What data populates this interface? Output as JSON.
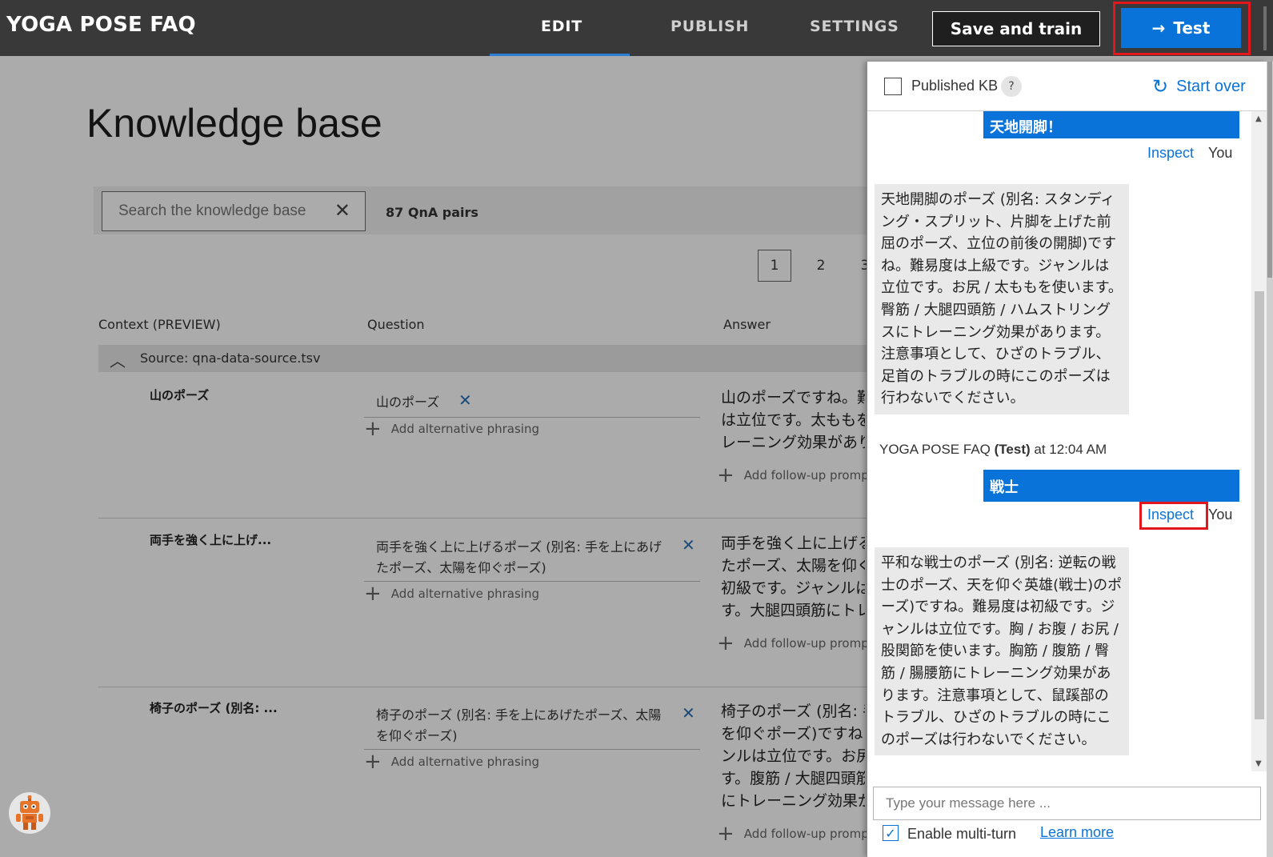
{
  "header": {
    "app_title": "YOGA POSE FAQ",
    "tabs": [
      "EDIT",
      "PUBLISH",
      "SETTINGS"
    ],
    "active_tab": "EDIT",
    "save_label": "Save and train",
    "test_label": "Test",
    "test_arrow": "→"
  },
  "kb": {
    "title": "Knowledge base",
    "search_placeholder": "Search the knowledge base",
    "clear_glyph": "✕",
    "pair_count": "87 QnA pairs",
    "pages": [
      "1",
      "2",
      "3"
    ],
    "current_page": "1",
    "columns": [
      "Context (PREVIEW)",
      "Question",
      "Answer"
    ],
    "source_chevron": "︿",
    "source": "Source: qna-data-source.tsv",
    "add_alt_label": "Add alternative phrasing",
    "add_follow_label": "Add follow-up prompt",
    "plus_glyph": "+",
    "remove_glyph": "✕",
    "rows": [
      {
        "context": "山のポーズ",
        "question": "山のポーズ",
        "answer": "山のポーズですね。難\nは立位です。太ももを\nレーニング効果があり"
      },
      {
        "context": "両手を強く上に上げ...",
        "question": "両手を強く上に上げるポーズ (別名: 手を上にあげたポーズ、太陽を仰ぐポーズ)",
        "answer": "両手を強く上に上げる\nたポーズ、太陽を仰ぐ\n初級です。ジャンルは\nす。大腿四頭筋にトレ"
      },
      {
        "context": "椅子のポーズ (別名: ...",
        "question": "椅子のポーズ (別名: 手を上にあげたポーズ、太陽を仰ぐポーズ)",
        "answer": "椅子のポーズ (別名: 手\nを仰ぐポーズ)ですね\nンルは立位です。お尻\nす。腹筋 / 大腿四頭筋\nにトレーニング効果が"
      }
    ]
  },
  "test_panel": {
    "published_kb_label": "Published KB",
    "published_kb_checked": false,
    "help_glyph": "?",
    "start_over_label": "Start over",
    "refresh_glyph": "↻",
    "messages": {
      "user1": "天地開脚！",
      "bot1": "天地開脚のポーズ (別名: スタンディング・スプリット、片脚を上げた前屈のポーズ、立位の前後の開脚)ですね。難易度は上級です。ジャンルは立位です。お尻 / 太ももを使います。臀筋 / 大腿四頭筋 / ハムストリングスにトレーニング効果があります。注意事項として、ひざのトラブル、足首のトラブルの時にこのポーズは行わないでください。",
      "bot_name": "YOGA POSE FAQ",
      "bot_tag": "(Test)",
      "time_text": "at 12:04 AM",
      "user2": "戦士",
      "bot2": "平和な戦士のポーズ (別名: 逆転の戦士のポーズ、天を仰ぐ英雄(戦士)のポーズ)ですね。難易度は初級です。ジャンルは立位です。胸 / お腹 / お尻 / 股関節を使います。胸筋 / 腹筋 / 臀筋 / 腸腰筋にトレーニング効果があります。注意事項として、鼠蹊部のトラブル、ひざのトラブルの時にこのポーズは行わないでください。"
    },
    "inspect_label": "Inspect",
    "you_label": "You",
    "scroll_up_glyph": "▲",
    "scroll_down_glyph": "▼",
    "input_placeholder": "Type your message here ...",
    "multi_turn_label": "Enable multi-turn",
    "multi_turn_checked": true,
    "check_glyph": "✓",
    "learn_more_label": "Learn more"
  },
  "colors": {
    "accent": "#0a73d9",
    "highlight": "#e3161c",
    "topbar": "#393939"
  }
}
